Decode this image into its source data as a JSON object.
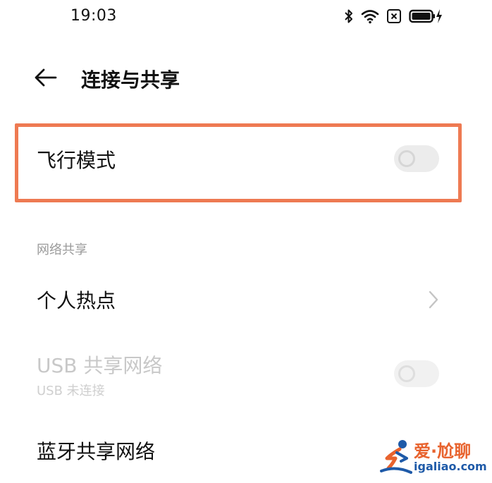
{
  "status_bar": {
    "time": "19:03",
    "icons": [
      "bluetooth-icon",
      "wifi-icon",
      "sim-off-icon",
      "battery-charging-icon"
    ]
  },
  "header": {
    "title": "连接与共享"
  },
  "airplane_mode": {
    "label": "飞行模式",
    "enabled": false,
    "highlight_color": "#ee7a52"
  },
  "network_sharing": {
    "section_title": "网络共享",
    "hotspot": {
      "label": "个人热点"
    },
    "usb_tethering": {
      "label": "USB 共享网络",
      "subtitle": "USB 未连接",
      "enabled": false,
      "disabled": true
    }
  },
  "bluetooth_tethering": {
    "label": "蓝牙共享网络"
  },
  "watermark": {
    "title": "爱·尬聊",
    "url": "igaliao.com"
  },
  "colors": {
    "text_primary": "#111111",
    "text_secondary": "#9a9a9a",
    "text_disabled": "#c8c8c8",
    "brand_orange": "#e8632e",
    "brand_blue": "#1e5aa8"
  }
}
